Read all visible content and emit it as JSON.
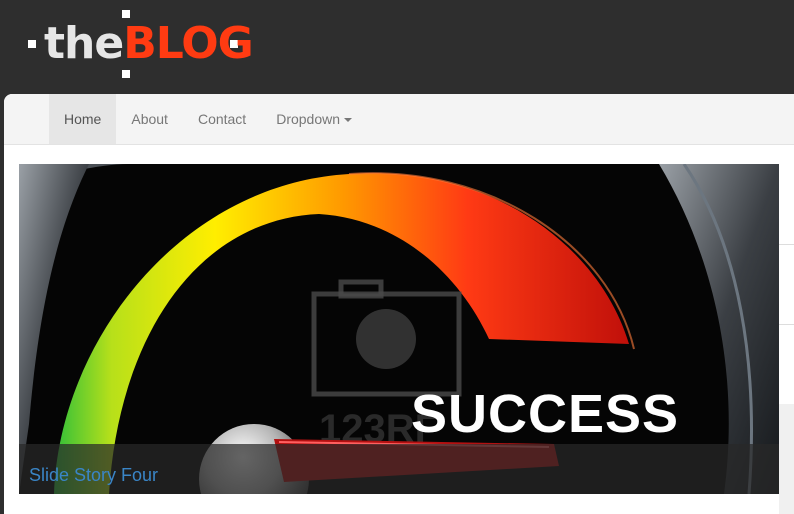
{
  "header": {
    "logo": {
      "prefix": "the",
      "brand": "BLOG",
      "brand_color": "#ff3b12"
    }
  },
  "navbar": {
    "items": [
      {
        "label": "Home",
        "active": true
      },
      {
        "label": "About"
      },
      {
        "label": "Contact"
      },
      {
        "label": "Dropdown",
        "has_caret": true
      }
    ]
  },
  "carousel": {
    "image_text": "SUCCESS",
    "caption": "Slide Story Four"
  },
  "colors": {
    "page_background": "#2e2e2e",
    "navbar_background": "#f4f4f4",
    "link_blue": "#3a85c6"
  }
}
